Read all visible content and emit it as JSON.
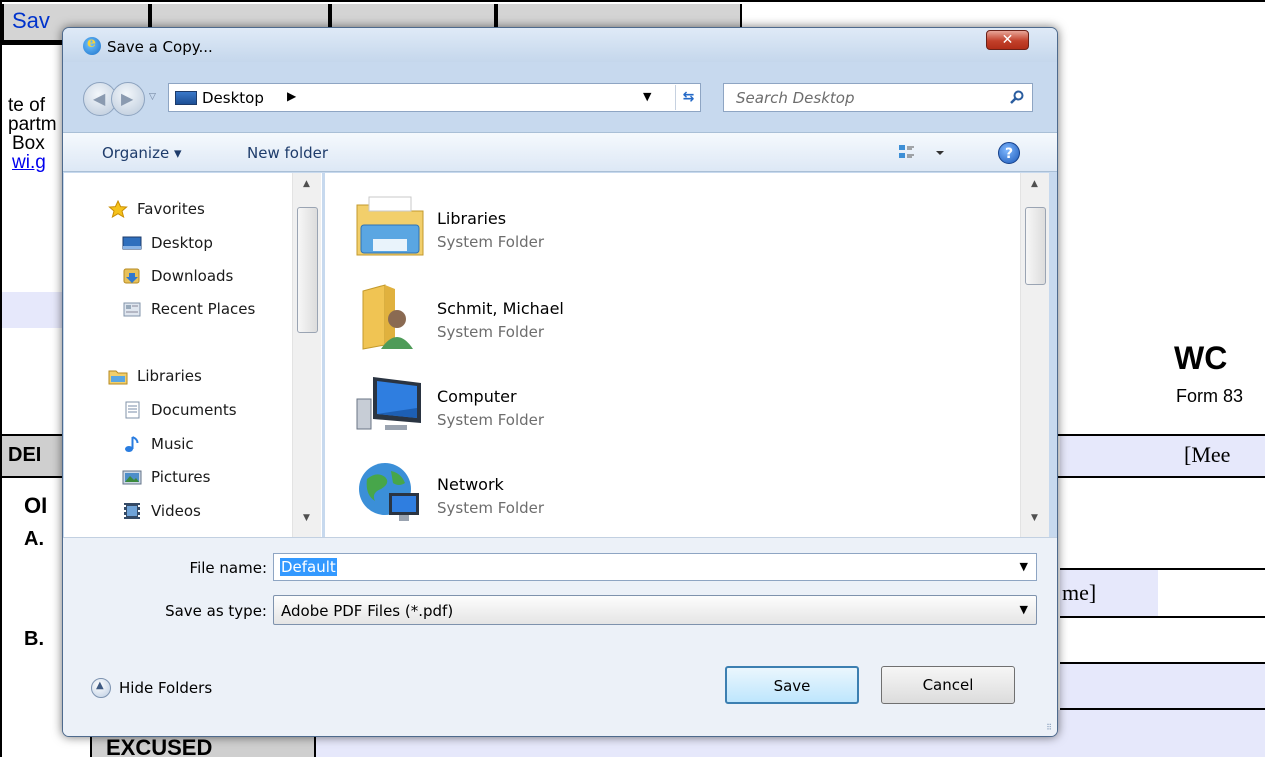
{
  "document": {
    "tabs": [
      "Sav"
    ],
    "left_fragments": [
      "te of",
      "partm",
      "Box",
      "wi.g"
    ],
    "ordel_label": "DEI",
    "section_o": "OI",
    "section_a": "A.",
    "section_b": "B.",
    "excused": "EXCUSED",
    "title_right": "WC",
    "form_right": "Form 83",
    "meeting_right": "[Mee",
    "name_right": "me]"
  },
  "dialog": {
    "title": "Save a Copy...",
    "close_label": "✕",
    "address": {
      "location": "Desktop",
      "separator": "▶"
    },
    "search_placeholder": "Search Desktop",
    "toolbar": {
      "organize": "Organize ▾",
      "new_folder": "New folder"
    },
    "nav_pane": {
      "items": [
        {
          "label": "Favorites",
          "icon": "star-icon"
        },
        {
          "label": "Desktop",
          "icon": "desktop-icon"
        },
        {
          "label": "Downloads",
          "icon": "downloads-icon"
        },
        {
          "label": "Recent Places",
          "icon": "recent-places-icon"
        },
        {
          "label": "Libraries",
          "icon": "libraries-icon"
        },
        {
          "label": "Documents",
          "icon": "documents-icon"
        },
        {
          "label": "Music",
          "icon": "music-icon"
        },
        {
          "label": "Pictures",
          "icon": "pictures-icon"
        },
        {
          "label": "Videos",
          "icon": "videos-icon"
        }
      ]
    },
    "files": [
      {
        "name": "Libraries",
        "type": "System Folder",
        "icon": "libraries-folder-icon"
      },
      {
        "name": "Schmit, Michael",
        "type": "System Folder",
        "icon": "user-folder-icon"
      },
      {
        "name": "Computer",
        "type": "System Folder",
        "icon": "computer-icon"
      },
      {
        "name": "Network",
        "type": "System Folder",
        "icon": "network-icon"
      }
    ],
    "form": {
      "file_name_label": "File name:",
      "file_name_value": "Default",
      "save_as_type_label": "Save as type:",
      "save_as_type_value": "Adobe PDF Files (*.pdf)",
      "hide_folders": "Hide Folders",
      "save": "Save",
      "cancel": "Cancel"
    }
  }
}
